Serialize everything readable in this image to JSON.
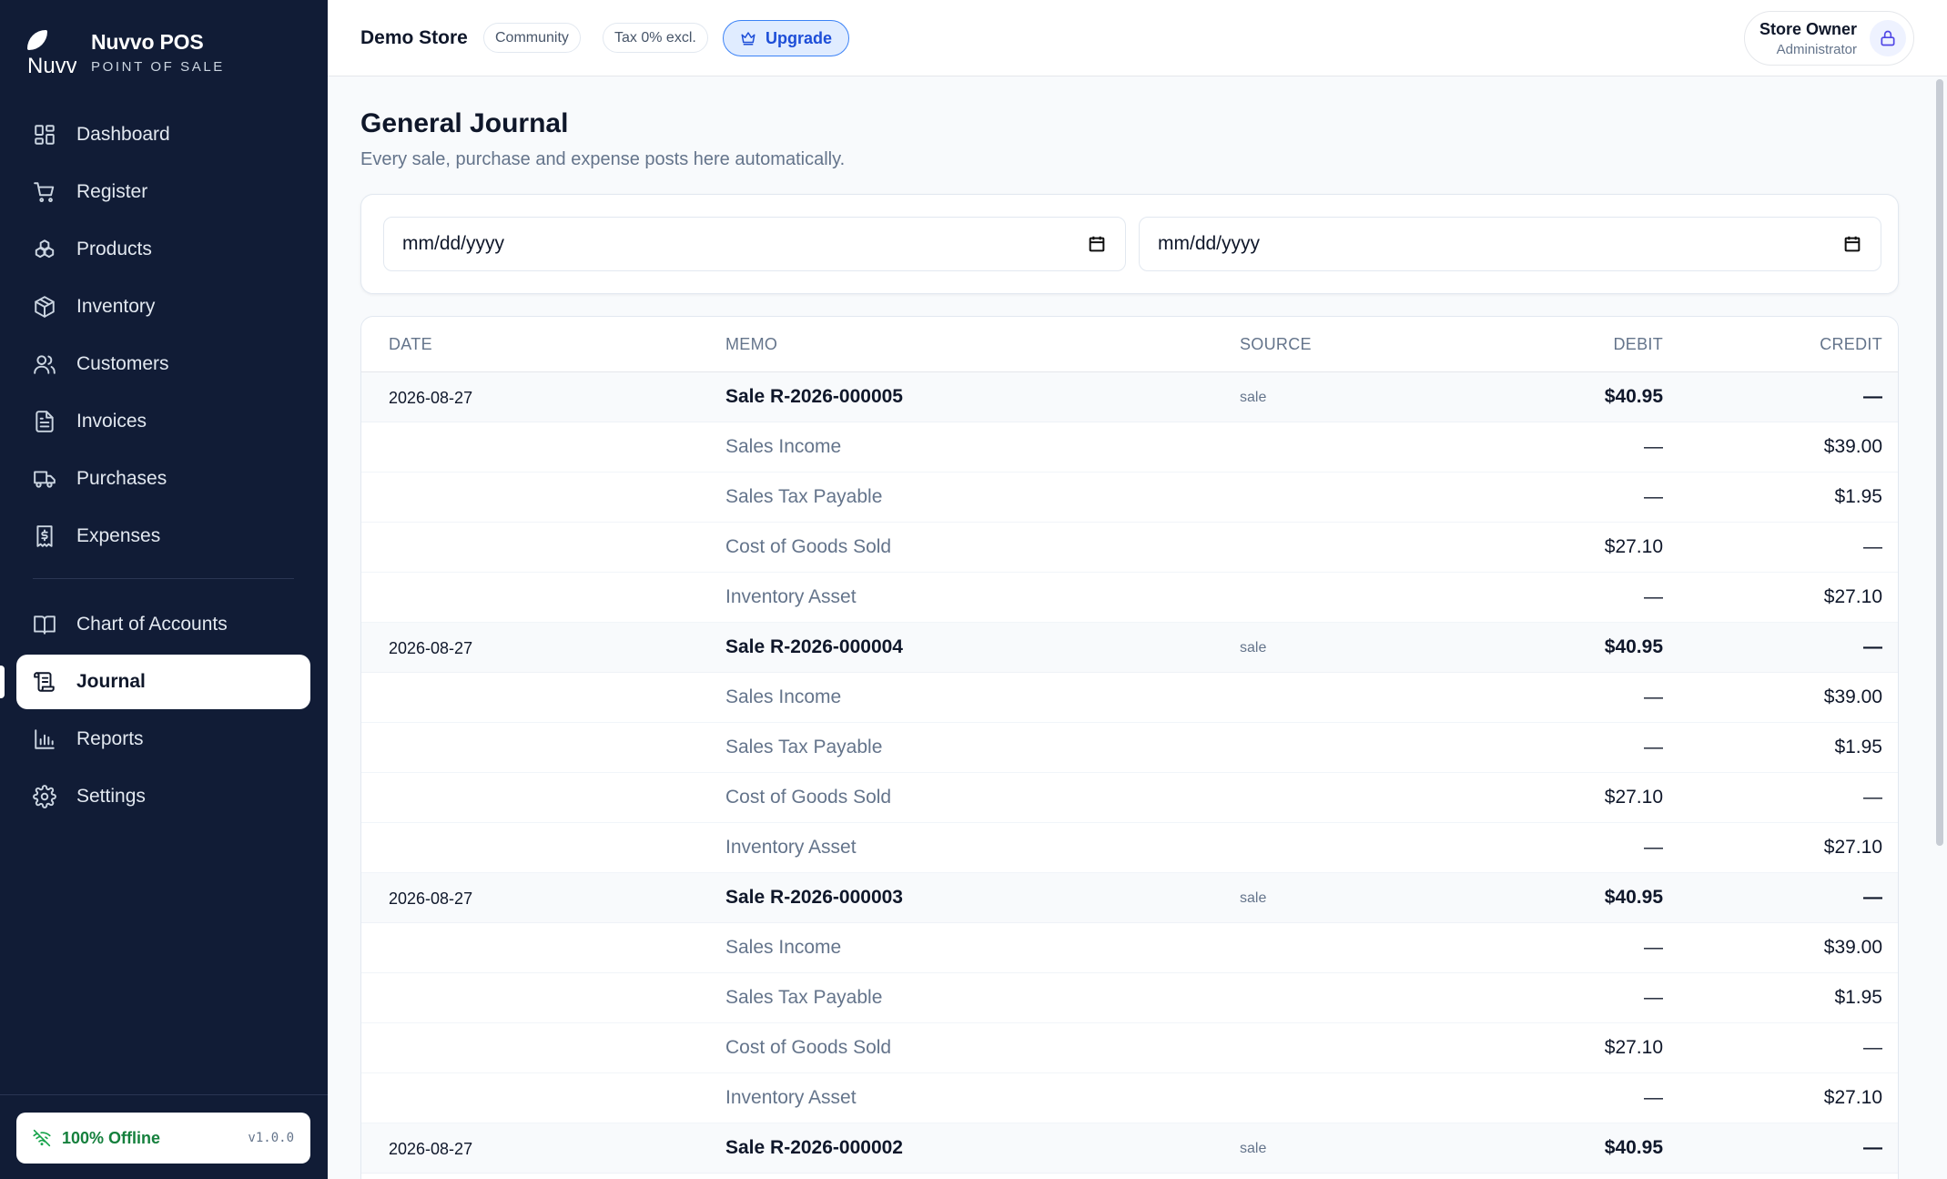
{
  "brand": {
    "name": "Nuvvo POS",
    "subtitle": "POINT OF SALE",
    "logo_alt": "Nuvvo"
  },
  "sidebar": {
    "items": [
      {
        "label": "Dashboard",
        "icon": "dashboard-icon"
      },
      {
        "label": "Register",
        "icon": "cart-icon"
      },
      {
        "label": "Products",
        "icon": "products-icon"
      },
      {
        "label": "Inventory",
        "icon": "box-icon"
      },
      {
        "label": "Customers",
        "icon": "users-icon"
      },
      {
        "label": "Invoices",
        "icon": "document-icon"
      },
      {
        "label": "Purchases",
        "icon": "truck-icon"
      },
      {
        "label": "Expenses",
        "icon": "receipt-icon"
      },
      {
        "label": "Chart of Accounts",
        "icon": "book-icon"
      },
      {
        "label": "Journal",
        "icon": "scroll-icon",
        "active": true
      },
      {
        "label": "Reports",
        "icon": "bar-chart-icon"
      },
      {
        "label": "Settings",
        "icon": "gear-icon"
      }
    ],
    "footer": {
      "status": "100% Offline",
      "version": "v1.0.0"
    }
  },
  "topbar": {
    "store_name": "Demo Store",
    "edition_badge": "Community",
    "tax_badge": "Tax 0% excl.",
    "upgrade_label": "Upgrade",
    "user_name": "Store Owner",
    "user_role": "Administrator"
  },
  "page": {
    "title": "General Journal",
    "subtitle": "Every sale, purchase and expense posts here automatically.",
    "date_from_placeholder": "mm/dd/yyyy",
    "date_to_placeholder": "mm/dd/yyyy"
  },
  "table": {
    "columns": {
      "date": "DATE",
      "memo": "MEMO",
      "source": "SOURCE",
      "debit": "DEBIT",
      "credit": "CREDIT"
    },
    "rows": [
      {
        "type": "head",
        "date": "2026-08-27",
        "memo": "Sale R-2026-000005",
        "source": "sale",
        "debit": "$40.95",
        "credit": "—"
      },
      {
        "type": "line",
        "date": "",
        "memo": "Sales Income",
        "source": "",
        "debit": "—",
        "credit": "$39.00"
      },
      {
        "type": "line",
        "date": "",
        "memo": "Sales Tax Payable",
        "source": "",
        "debit": "—",
        "credit": "$1.95"
      },
      {
        "type": "line",
        "date": "",
        "memo": "Cost of Goods Sold",
        "source": "",
        "debit": "$27.10",
        "credit": "—"
      },
      {
        "type": "line",
        "date": "",
        "memo": "Inventory Asset",
        "source": "",
        "debit": "—",
        "credit": "$27.10"
      },
      {
        "type": "head",
        "date": "2026-08-27",
        "memo": "Sale R-2026-000004",
        "source": "sale",
        "debit": "$40.95",
        "credit": "—"
      },
      {
        "type": "line",
        "date": "",
        "memo": "Sales Income",
        "source": "",
        "debit": "—",
        "credit": "$39.00"
      },
      {
        "type": "line",
        "date": "",
        "memo": "Sales Tax Payable",
        "source": "",
        "debit": "—",
        "credit": "$1.95"
      },
      {
        "type": "line",
        "date": "",
        "memo": "Cost of Goods Sold",
        "source": "",
        "debit": "$27.10",
        "credit": "—"
      },
      {
        "type": "line",
        "date": "",
        "memo": "Inventory Asset",
        "source": "",
        "debit": "—",
        "credit": "$27.10"
      },
      {
        "type": "head",
        "date": "2026-08-27",
        "memo": "Sale R-2026-000003",
        "source": "sale",
        "debit": "$40.95",
        "credit": "—"
      },
      {
        "type": "line",
        "date": "",
        "memo": "Sales Income",
        "source": "",
        "debit": "—",
        "credit": "$39.00"
      },
      {
        "type": "line",
        "date": "",
        "memo": "Sales Tax Payable",
        "source": "",
        "debit": "—",
        "credit": "$1.95"
      },
      {
        "type": "line",
        "date": "",
        "memo": "Cost of Goods Sold",
        "source": "",
        "debit": "$27.10",
        "credit": "—"
      },
      {
        "type": "line",
        "date": "",
        "memo": "Inventory Asset",
        "source": "",
        "debit": "—",
        "credit": "$27.10"
      },
      {
        "type": "head",
        "date": "2026-08-27",
        "memo": "Sale R-2026-000002",
        "source": "sale",
        "debit": "$40.95",
        "credit": "—"
      }
    ]
  },
  "colors": {
    "sidebar_bg": "#111c36",
    "accent": "#1d4ed8",
    "offline_green": "#15803d"
  }
}
